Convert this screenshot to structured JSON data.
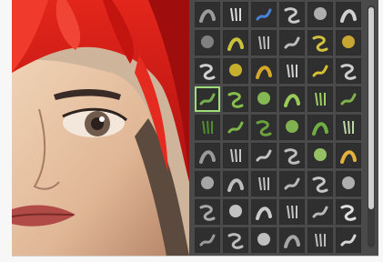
{
  "artwork": {
    "description_label": ""
  },
  "brush_panel": {
    "rows": [
      {
        "tiles": [
          {
            "icon": "soft-round-brush-icon",
            "color": "#9b9b9b",
            "pixels": ""
          },
          {
            "icon": "scatter-dots-brush-icon",
            "color": "#dcdcdc",
            "pixels": ""
          },
          {
            "icon": "tip-shape-brush-icon",
            "color": "#4a82d8",
            "pixels": ""
          },
          {
            "icon": "smudge-brush-icon",
            "color": "#c9c9c9",
            "pixels": ""
          },
          {
            "icon": "dry-ink-brush-icon",
            "color": "#bcbcbc",
            "pixels": ""
          },
          {
            "icon": "texture-brush-icon",
            "color": "#d0d0d0",
            "pixels": ""
          }
        ]
      },
      {
        "tiles": [
          {
            "icon": "pen-brush-icon",
            "color": "#8a8a8a",
            "pixels": ""
          },
          {
            "icon": "pencil-brush-icon",
            "color": "#c9c23a",
            "pixels": ""
          },
          {
            "icon": "marker-brush-icon",
            "color": "#bdbdbd",
            "pixels": ""
          },
          {
            "icon": "chalk-brush-icon",
            "color": "#bcbcbc",
            "pixels": ""
          },
          {
            "icon": "flat-brush-icon",
            "color": "#d5c13a",
            "pixels": ""
          },
          {
            "icon": "curve-brush-icon",
            "color": "#d8b432",
            "pixels": ""
          }
        ]
      },
      {
        "tiles": [
          {
            "icon": "round-brush-icon",
            "color": "#d0d0d0",
            "pixels": ""
          },
          {
            "icon": "yellow-stroke-brush-icon",
            "color": "#d6be2d",
            "pixels": ""
          },
          {
            "icon": "yellow-swirl-brush-icon",
            "color": "#d6a82a",
            "pixels": ""
          },
          {
            "icon": "grass-stroke-brush-icon",
            "color": "#cfcfcf",
            "pixels": ""
          },
          {
            "icon": "oil-brush-icon",
            "color": "#d6c02d",
            "pixels": ""
          },
          {
            "icon": "spatter-brush-icon",
            "color": "#cfcfcf",
            "pixels": ""
          }
        ]
      },
      {
        "tiles": [
          {
            "icon": "soft-airbrush-icon",
            "color": "#76b04d",
            "pixels": "",
            "selected": true
          },
          {
            "icon": "green-swirl-brush-icon",
            "color": "#86c04a",
            "pixels": ""
          },
          {
            "icon": "green-stroke-brush-icon",
            "color": "#8fc856",
            "pixels": ""
          },
          {
            "icon": "green-scribble-brush-icon",
            "color": "#9acb5a",
            "pixels": ""
          },
          {
            "icon": "green-dots-brush-icon",
            "color": "#9ccf64",
            "pixels": ""
          },
          {
            "icon": "green-flat-brush-icon",
            "color": "#7fb24b",
            "pixels": ""
          }
        ]
      },
      {
        "tiles": [
          {
            "icon": "foliage-brush-icon",
            "color": "#4f8d2d",
            "pixels": ""
          },
          {
            "icon": "grass-blade-brush-icon",
            "color": "#7db548",
            "pixels": ""
          },
          {
            "icon": "leaf-brush-icon",
            "color": "#6aa23c",
            "pixels": ""
          },
          {
            "icon": "green-texture-brush-icon",
            "color": "#88c050",
            "pixels": ""
          },
          {
            "icon": "moss-brush-icon",
            "color": "#6fae43",
            "pixels": ""
          },
          {
            "icon": "clouds-brush-icon",
            "color": "#bcd6a8",
            "pixels": ""
          }
        ]
      },
      {
        "tiles": [
          {
            "icon": "thin-line-brush-icon",
            "color": "#9a9a9a",
            "pixels": ""
          },
          {
            "icon": "hook-brush-icon",
            "color": "#c7c7c7",
            "pixels": ""
          },
          {
            "icon": "coil-brush-icon",
            "color": "#c2c2c2",
            "pixels": ""
          },
          {
            "icon": "wave-brush-icon",
            "color": "#bdbdbd",
            "pixels": ""
          },
          {
            "icon": "flask-brush-icon",
            "color": "#9ed16a",
            "pixels": ""
          },
          {
            "icon": "spark-brush-icon",
            "color": "#e2b23c",
            "pixels": ""
          }
        ]
      },
      {
        "tiles": [
          {
            "icon": "dotted-brush-icon",
            "color": "#b3b3b3",
            "pixels": ""
          },
          {
            "icon": "crosshatch-brush-icon",
            "color": "#bdbdbd",
            "pixels": ""
          },
          {
            "icon": "noise-brush-icon",
            "color": "#c2c2c2",
            "pixels": ""
          },
          {
            "icon": "rough-brush-icon",
            "color": "#b8b8b8",
            "pixels": ""
          },
          {
            "icon": "smoke-brush-icon",
            "color": "#c6c6c6",
            "pixels": ""
          },
          {
            "icon": "fur-brush-icon",
            "color": "#bdbdbd",
            "pixels": ""
          }
        ]
      },
      {
        "tiles": [
          {
            "icon": "bristle-brush-icon",
            "color": "#a9a9a9",
            "pixels": ""
          },
          {
            "icon": "dust-brush-icon",
            "color": "#d3d3d3",
            "pixels": ""
          },
          {
            "icon": "stone-brush-icon",
            "color": "#cacaca",
            "pixels": ""
          },
          {
            "icon": "crack-brush-icon",
            "color": "#c2c2c2",
            "pixels": ""
          },
          {
            "icon": "sponge-brush-icon",
            "color": "#b8b8b8",
            "pixels": ""
          },
          {
            "icon": "sparkle-brush-icon",
            "color": "#e0e0e0",
            "pixels": ""
          }
        ]
      },
      {
        "tiles": [
          {
            "icon": "hair-brush-icon",
            "color": "#9a9a9a",
            "pixels": ""
          },
          {
            "icon": "grunge-brush-icon",
            "color": "#bdbdbd",
            "pixels": ""
          },
          {
            "icon": "gravel-brush-icon",
            "color": "#cfcfcf",
            "pixels": ""
          },
          {
            "icon": "rain-brush-icon",
            "color": "#a6a6a6",
            "pixels": ""
          },
          {
            "icon": "pattern-brush-icon",
            "color": "#bdbdbd",
            "pixels": ""
          },
          {
            "icon": "stars-brush-icon",
            "color": "#d6d6d6",
            "pixels": ""
          }
        ]
      }
    ]
  },
  "colors": {
    "hair": "#d81812",
    "skin": "#e6c2a4",
    "panel_bg": "#4a4a4a",
    "selection": "#9fdc7a"
  }
}
